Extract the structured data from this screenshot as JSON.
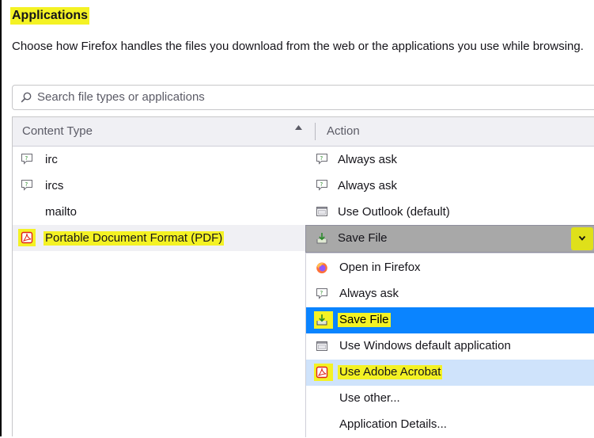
{
  "title": "Applications",
  "description": "Choose how Firefox handles the files you download from the web or the applications you use while browsing.",
  "search": {
    "placeholder": "Search file types or applications"
  },
  "table": {
    "columns": {
      "content_type": "Content Type",
      "action": "Action"
    },
    "rows": [
      {
        "content_type": "irc",
        "icon": "chat-icon",
        "action": "Always ask",
        "action_icon": "chat-icon"
      },
      {
        "content_type": "ircs",
        "icon": "chat-icon",
        "action": "Always ask",
        "action_icon": "chat-icon"
      },
      {
        "content_type": "mailto",
        "icon": "",
        "action": "Use Outlook (default)",
        "action_icon": "application-window-icon"
      },
      {
        "content_type": "Portable Document Format (PDF)",
        "icon": "pdf-icon",
        "action": "Save File",
        "action_icon": "download-save-icon"
      }
    ]
  },
  "action_menu": {
    "selected": "Save File",
    "items": [
      {
        "label": "Open in Firefox",
        "icon": "firefox-icon"
      },
      {
        "label": "Always ask",
        "icon": "chat-icon"
      },
      {
        "label": "Save File",
        "icon": "download-save-icon"
      },
      {
        "label": "Use Windows default application",
        "icon": "application-window-icon"
      },
      {
        "label": "Use Adobe Acrobat",
        "icon": "pdf-icon"
      },
      {
        "label": "Use other...",
        "icon": ""
      },
      {
        "label": "Application Details...",
        "icon": ""
      }
    ]
  },
  "colors": {
    "highlight": "#f4f224",
    "menu_active": "#0a84ff",
    "menu_hover": "#cfe3fb",
    "header_bg": "#f0f0f4",
    "select_bg": "#a8a8a8"
  }
}
